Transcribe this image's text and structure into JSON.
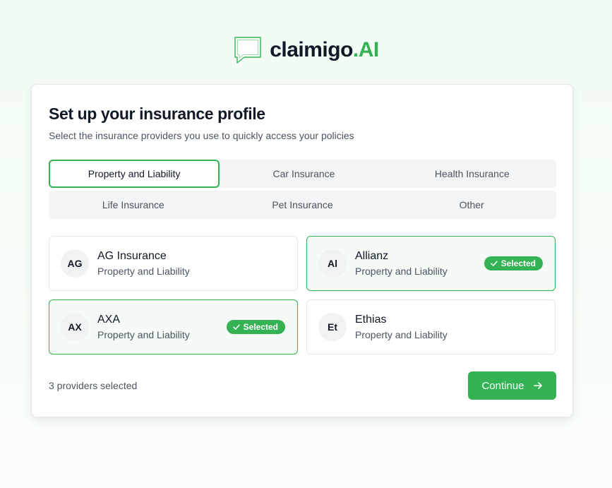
{
  "brand": {
    "name": "claimigo",
    "suffix": ".AI",
    "icon": "chat-bubble-icon",
    "accent_color": "#34b254"
  },
  "setup": {
    "title": "Set up your insurance profile",
    "subtitle": "Select the insurance providers you use to quickly access your policies"
  },
  "tabs": {
    "row1": [
      "Property and Liability",
      "Car Insurance",
      "Health Insurance"
    ],
    "row2": [
      "Life Insurance",
      "Pet Insurance",
      "Other"
    ],
    "active": "Property and Liability"
  },
  "providers": [
    {
      "initials": "AG",
      "name": "AG Insurance",
      "category": "Property and Liability",
      "selected": false
    },
    {
      "initials": "Al",
      "name": "Allianz",
      "category": "Property and Liability",
      "selected": true,
      "badge": "Selected"
    },
    {
      "initials": "AX",
      "name": "AXA",
      "category": "Property and Liability",
      "selected": true,
      "badge": "Selected"
    },
    {
      "initials": "Et",
      "name": "Ethias",
      "category": "Property and Liability",
      "selected": false
    }
  ],
  "footer": {
    "count_text": "3 providers selected",
    "continue_label": "Continue",
    "continue_icon": "arrow-right-icon"
  }
}
